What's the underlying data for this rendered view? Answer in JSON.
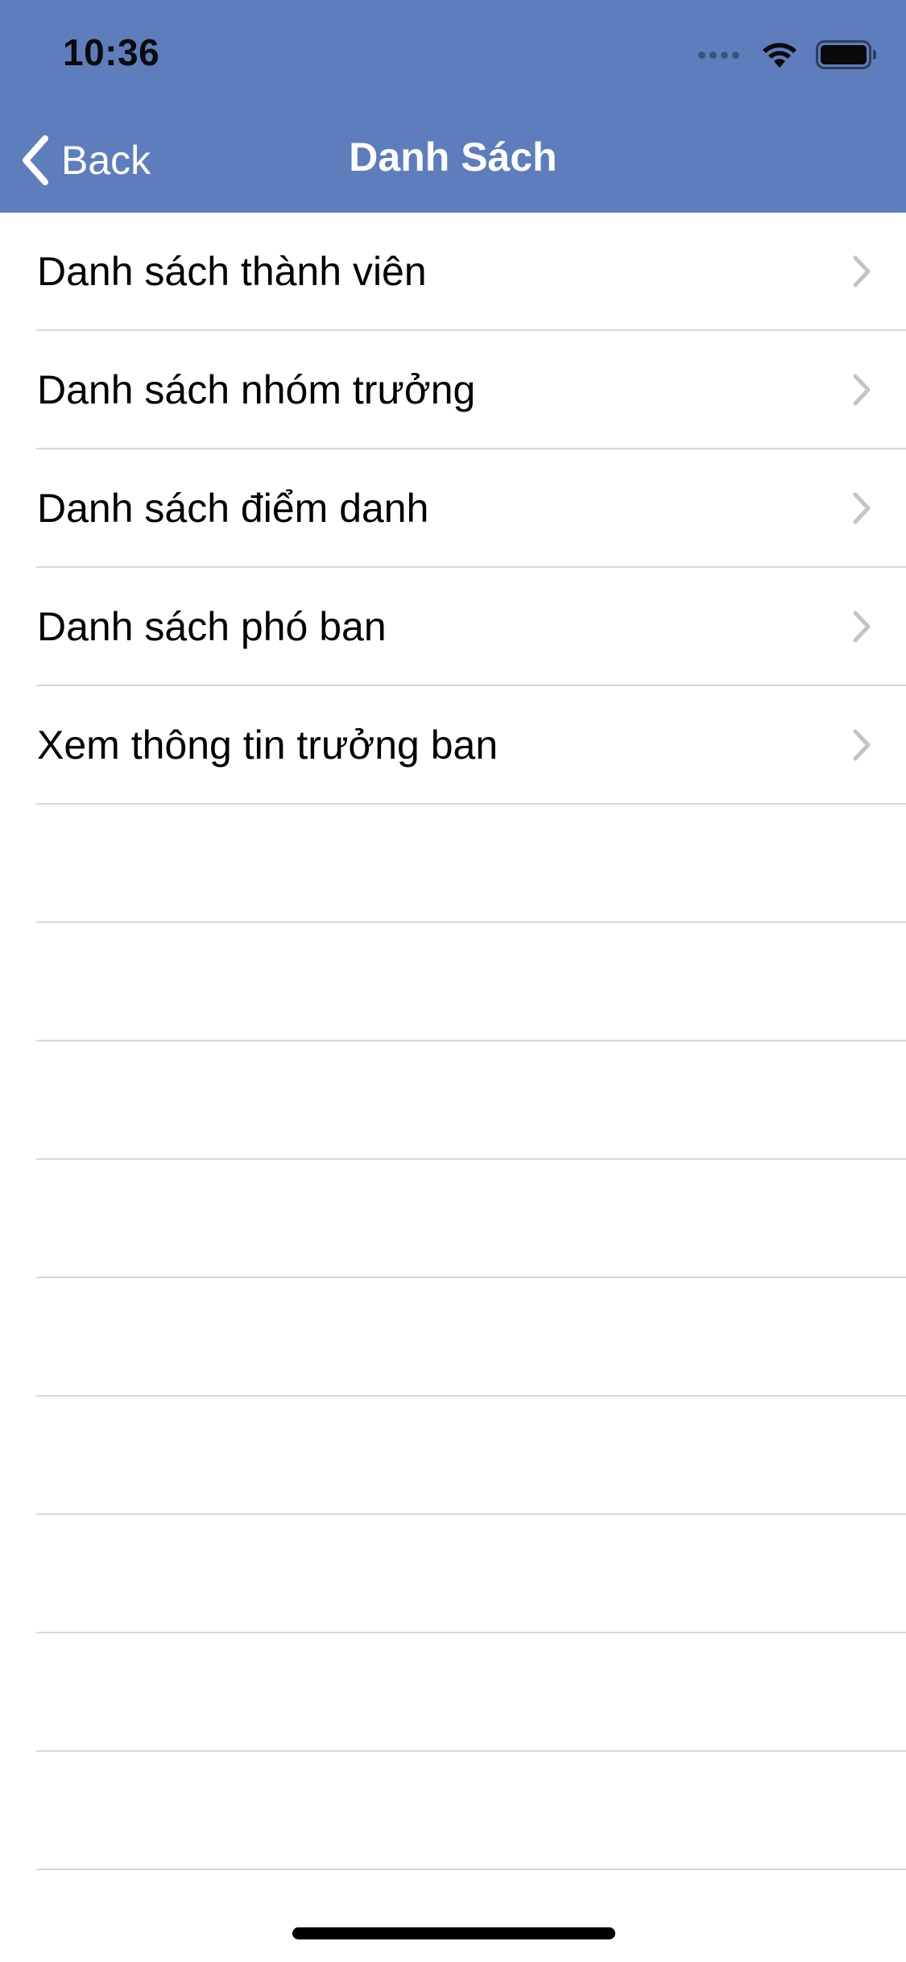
{
  "status_bar": {
    "time": "10:36",
    "icons": [
      "signal-icon",
      "wifi-icon",
      "battery-icon"
    ]
  },
  "nav_bar": {
    "back_label": "Back",
    "title": "Danh Sách",
    "background_color": "#5d7dbd"
  },
  "list": {
    "items": [
      {
        "label": "Danh sách thành viên"
      },
      {
        "label": "Danh sách nhóm trưởng"
      },
      {
        "label": "Danh sách điểm danh"
      },
      {
        "label": "Danh sách phó ban"
      },
      {
        "label": "Xem thông tin trưởng ban"
      }
    ],
    "chevron_icon": "chevron-right-icon"
  }
}
